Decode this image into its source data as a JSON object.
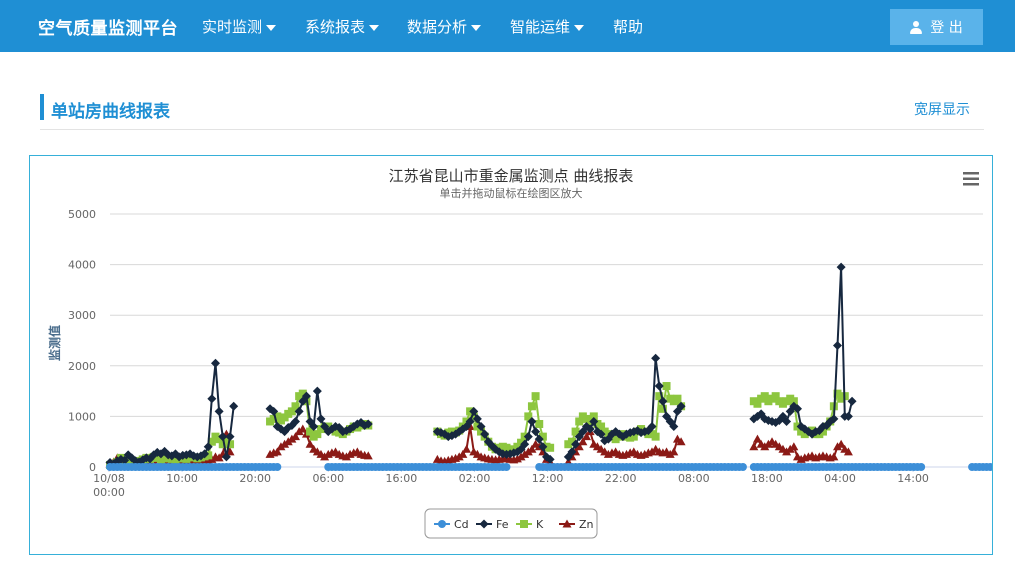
{
  "app": {
    "title": "空气质量监测平台"
  },
  "nav": {
    "items": [
      {
        "label": "实时监测",
        "dropdown": true
      },
      {
        "label": "系统报表",
        "dropdown": true
      },
      {
        "label": "数据分析",
        "dropdown": true
      },
      {
        "label": "智能运维",
        "dropdown": true
      },
      {
        "label": "帮助",
        "dropdown": false
      }
    ],
    "logout_label": "登 出"
  },
  "section": {
    "title": "单站房曲线报表",
    "fullscreen_label": "宽屏显示"
  },
  "colors": {
    "accent": "#1f8fd4",
    "panel_border": "#36b0d9"
  },
  "chart_data": {
    "type": "line",
    "title": "江苏省昆山市重金属监测点 曲线报表",
    "subtitle": "单击并拖动鼠标在绘图区放大",
    "ylabel": "监测值",
    "ylim": [
      0,
      5000
    ],
    "yticks": [
      "0",
      "1000",
      "2000",
      "3000",
      "4000",
      "5000"
    ],
    "xticks": [
      "10/08 00:00",
      "10:00",
      "20:00",
      "06:00",
      "16:00",
      "02:00",
      "12:00",
      "22:00",
      "08:00",
      "18:00",
      "04:00",
      "14:00"
    ],
    "grid": true,
    "legend": "bottom-center",
    "series": [
      {
        "name": "Cd",
        "color": "#3d8fd8",
        "marker": "circle",
        "segments": [
          [
            0,
            [
              0,
              0,
              0,
              0,
              0,
              0,
              0,
              0,
              0,
              0,
              0,
              0,
              0,
              0,
              0,
              0,
              0,
              0,
              0,
              0,
              0,
              0,
              0,
              0,
              0,
              0,
              0,
              0,
              0,
              0,
              0,
              0,
              0,
              0,
              0,
              0,
              0,
              0,
              0,
              0,
              0,
              0,
              0,
              0,
              0,
              0,
              0
            ]
          ],
          [
            60,
            [
              0,
              0,
              0,
              0,
              0,
              0,
              0,
              0,
              0,
              0,
              0,
              0,
              0,
              0,
              0,
              0,
              0,
              0,
              0,
              0,
              0,
              0,
              0,
              0,
              0,
              0,
              0,
              0,
              0,
              0,
              0,
              0,
              0,
              0,
              0,
              0,
              0,
              0,
              0,
              0,
              0,
              0,
              0,
              0,
              0,
              0,
              0,
              0,
              0,
              0
            ]
          ],
          [
            118,
            [
              0,
              0,
              0,
              0,
              0,
              0,
              0,
              0,
              0,
              0,
              0,
              0,
              0,
              0,
              0,
              0,
              0,
              0,
              0,
              0,
              0,
              0,
              0,
              0,
              0,
              0,
              0,
              0,
              0,
              0,
              0,
              0,
              0,
              0,
              0,
              0,
              0,
              0,
              0,
              0,
              0,
              0,
              0,
              0,
              0,
              0,
              0,
              0,
              0,
              0,
              0,
              0,
              0,
              0,
              0,
              0,
              0
            ]
          ],
          [
            177,
            [
              0,
              0,
              0,
              0,
              0,
              0,
              0,
              0,
              0,
              0,
              0,
              0,
              0,
              0,
              0,
              0,
              0,
              0,
              0,
              0,
              0,
              0,
              0,
              0,
              0,
              0,
              0,
              0,
              0,
              0,
              0,
              0,
              0,
              0,
              0,
              0,
              0,
              0,
              0,
              0,
              0,
              0,
              0,
              0,
              0,
              0,
              0
            ]
          ],
          [
            237,
            [
              0,
              0,
              0,
              0,
              0,
              0,
              0,
              0,
              0,
              0,
              0,
              0,
              0,
              0,
              0,
              0,
              0,
              0,
              0,
              0,
              0,
              0,
              0,
              0,
              0,
              0,
              0,
              0,
              0,
              0,
              0,
              0,
              0,
              0,
              0,
              0,
              0,
              0,
              0,
              0,
              0,
              0,
              0,
              0,
              0,
              0,
              0
            ]
          ]
        ]
      },
      {
        "name": "Fe",
        "color": "#17283f",
        "marker": "diamond",
        "segments": [
          [
            0,
            [
              90,
              60,
              120,
              150,
              130,
              240,
              180,
              120,
              100,
              140,
              180,
              160,
              240,
              290,
              260,
              310,
              240,
              220,
              260,
              200,
              230,
              240,
              260,
              220,
              200,
              220,
              260,
              400,
              1350,
              2050,
              1100,
              600,
              200,
              600,
              1200
            ]
          ],
          [
            44,
            [
              1150,
              1100,
              800,
              750,
              700,
              780,
              820,
              900,
              1100,
              1300,
              1400,
              900,
              800,
              1500,
              950,
              800,
              700,
              750,
              800,
              780,
              700,
              720,
              750,
              800,
              850,
              880,
              820,
              850
            ]
          ],
          [
            90,
            [
              700,
              680,
              650,
              600,
              620,
              650,
              700,
              750,
              800,
              900,
              1100,
              950,
              800,
              650,
              500,
              420,
              350,
              300,
              260,
              250,
              260,
              280,
              300,
              350,
              450,
              600,
              900,
              700,
              550,
              400,
              200,
              150
            ]
          ],
          [
            126,
            [
              200,
              300,
              450,
              600,
              700,
              800,
              750,
              900,
              700,
              650,
              520,
              550,
              650,
              700,
              650,
              600,
              650,
              680,
              700,
              720,
              680,
              700,
              720,
              800,
              2150,
              1600,
              1300,
              1000,
              900,
              800,
              1100,
              1200
            ]
          ],
          [
            177,
            [
              950,
              1000,
              1050,
              950,
              920,
              900,
              880,
              920,
              1000,
              900,
              1100,
              1200,
              1150,
              800,
              750,
              700,
              650,
              700,
              720,
              800,
              820,
              900,
              950,
              2400,
              3950,
              1000,
              1000,
              1300
            ]
          ]
        ]
      },
      {
        "name": "K",
        "color": "#8dc63f",
        "marker": "square",
        "segments": [
          [
            0,
            [
              40,
              60,
              100,
              180,
              130,
              80,
              90,
              120,
              110,
              150,
              180,
              160,
              200,
              180,
              150,
              170,
              190,
              160,
              150,
              170,
              180,
              160,
              200,
              190,
              170,
              190,
              210,
              230,
              500,
              600,
              550,
              450,
              500,
              450
            ]
          ],
          [
            44,
            [
              900,
              950,
              1000,
              920,
              980,
              1050,
              1100,
              1200,
              1400,
              1450,
              1300,
              700,
              600,
              650,
              750,
              800,
              800,
              750,
              700,
              680,
              650,
              700,
              750,
              800,
              780,
              820,
              850,
              820
            ]
          ],
          [
            90,
            [
              700,
              650,
              620,
              680,
              700,
              680,
              720,
              800,
              900,
              1100,
              1000,
              800,
              700,
              600,
              500,
              400,
              350,
              380,
              400,
              380,
              350,
              320,
              400,
              480,
              600,
              1000,
              1200,
              1400,
              850,
              600,
              400,
              380
            ]
          ],
          [
            126,
            [
              450,
              500,
              700,
              900,
              1000,
              950,
              900,
              1000,
              850,
              800,
              700,
              650,
              600,
              550,
              600,
              650,
              600,
              580,
              600,
              700,
              750,
              700,
              650,
              650,
              600,
              1400,
              1150,
              1600,
              1350,
              1300,
              1350,
              1200
            ]
          ],
          [
            177,
            [
              1300,
              1250,
              1350,
              1400,
              1300,
              1350,
              1400,
              1300,
              1250,
              1300,
              1350,
              1300,
              800,
              700,
              650,
              700,
              720,
              650,
              650,
              700,
              800,
              900,
              1200,
              1450,
              1350,
              1400
            ]
          ]
        ]
      },
      {
        "name": "Zn",
        "color": "#8b1a16",
        "marker": "triangle",
        "segments": [
          [
            0,
            [
              60,
              100,
              180,
              150,
              120,
              80,
              70,
              90,
              100,
              80,
              70,
              60,
              80,
              90,
              100,
              70,
              60,
              80,
              90,
              70,
              60,
              80,
              90,
              100,
              80,
              90,
              100,
              120,
              150,
              200,
              180,
              250,
              650,
              300
            ]
          ],
          [
            44,
            [
              250,
              280,
              300,
              400,
              450,
              500,
              550,
              600,
              700,
              750,
              650,
              450,
              350,
              300,
              250,
              200,
              250,
              280,
              300,
              250,
              220,
              200,
              250,
              280,
              300,
              250,
              230,
              220
            ]
          ],
          [
            90,
            [
              150,
              120,
              110,
              130,
              150,
              170,
              200,
              250,
              350,
              800,
              300,
              250,
              200,
              180,
              160,
              150,
              140,
              150,
              160,
              170,
              150,
              140,
              160,
              200,
              250,
              300,
              350,
              450,
              400,
              300,
              150,
              100
            ]
          ],
          [
            126,
            [
              100,
              200,
              300,
              400,
              500,
              600,
              700,
              450,
              400,
              350,
              300,
              250,
              280,
              300,
              250,
              230,
              250,
              280,
              300,
              250,
              230,
              250,
              280,
              300,
              350,
              300,
              280,
              300,
              250,
              300,
              550,
              500
            ]
          ],
          [
            177,
            [
              400,
              550,
              450,
              400,
              450,
              500,
              450,
              400,
              350,
              300,
              350,
              400,
              200,
              150,
              180,
              200,
              220,
              180,
              200,
              220,
              200,
              180,
              200,
              400,
              450,
              350,
              300
            ]
          ]
        ]
      }
    ]
  }
}
